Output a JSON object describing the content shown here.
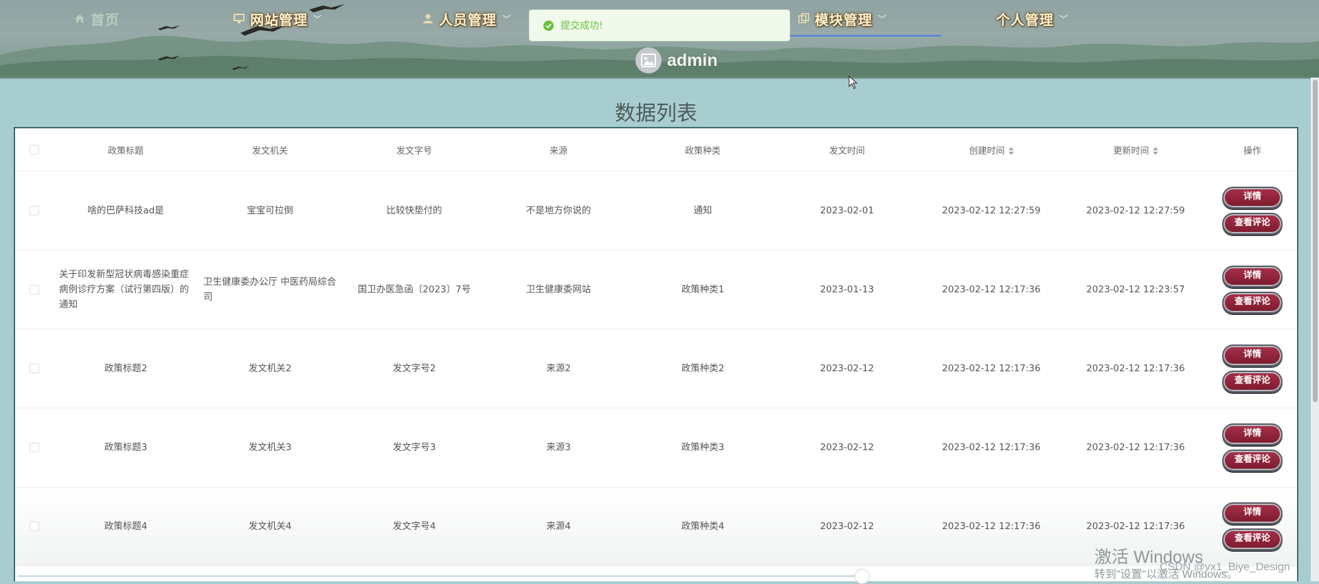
{
  "nav": {
    "home": "首页",
    "items": [
      {
        "label": "网站管理"
      },
      {
        "label": "人员管理"
      },
      {
        "label": "模块管理"
      },
      {
        "label": "个人管理"
      }
    ]
  },
  "user": {
    "name": "admin"
  },
  "toast": {
    "message": "提交成功!"
  },
  "page": {
    "title": "数据列表"
  },
  "table": {
    "headers": [
      "政策标题",
      "发文机关",
      "发文字号",
      "来源",
      "政策种类",
      "发文时间",
      "创建时间",
      "更新时间",
      "操作"
    ],
    "rows": [
      {
        "title": "啥的巴萨科技ad是",
        "org": "宝宝可拉倒",
        "number": "比较快垫付的",
        "source": "不是地方你说的",
        "category": "通知",
        "date": "2023-02-01",
        "created": "2023-02-12 12:27:59",
        "updated": "2023-02-12 12:27:59"
      },
      {
        "title": "关于印发新型冠状病毒感染重症病例诊疗方案（试行第四版）的通知",
        "org": "卫生健康委办公厅 中医药局综合司",
        "number": "国卫办医急函〔2023〕7号",
        "source": "卫生健康委网站",
        "category": "政策种类1",
        "date": "2023-01-13",
        "created": "2023-02-12 12:17:36",
        "updated": "2023-02-12 12:23:57"
      },
      {
        "title": "政策标题2",
        "org": "发文机关2",
        "number": "发文字号2",
        "source": "来源2",
        "category": "政策种类2",
        "date": "2023-02-12",
        "created": "2023-02-12 12:17:36",
        "updated": "2023-02-12 12:17:36"
      },
      {
        "title": "政策标题3",
        "org": "发文机关3",
        "number": "发文字号3",
        "source": "来源3",
        "category": "政策种类3",
        "date": "2023-02-12",
        "created": "2023-02-12 12:17:36",
        "updated": "2023-02-12 12:17:36"
      },
      {
        "title": "政策标题4",
        "org": "发文机关4",
        "number": "发文字号4",
        "source": "来源4",
        "category": "政策种类4",
        "date": "2023-02-12",
        "created": "2023-02-12 12:17:36",
        "updated": "2023-02-12 12:17:36"
      }
    ],
    "actions": {
      "detail": "详情",
      "comments": "查看评论"
    }
  },
  "overlay": {
    "watermark_line1": "激活 Windows",
    "watermark_line2": "转到\"设置\"以激活 Windows。",
    "csdn": "CSDN @vx1_Biye_Design"
  },
  "colors": {
    "accent": "#4a7fe0",
    "button": "#8e2238",
    "toast": "#67c23a",
    "border": "#3d6b69"
  }
}
